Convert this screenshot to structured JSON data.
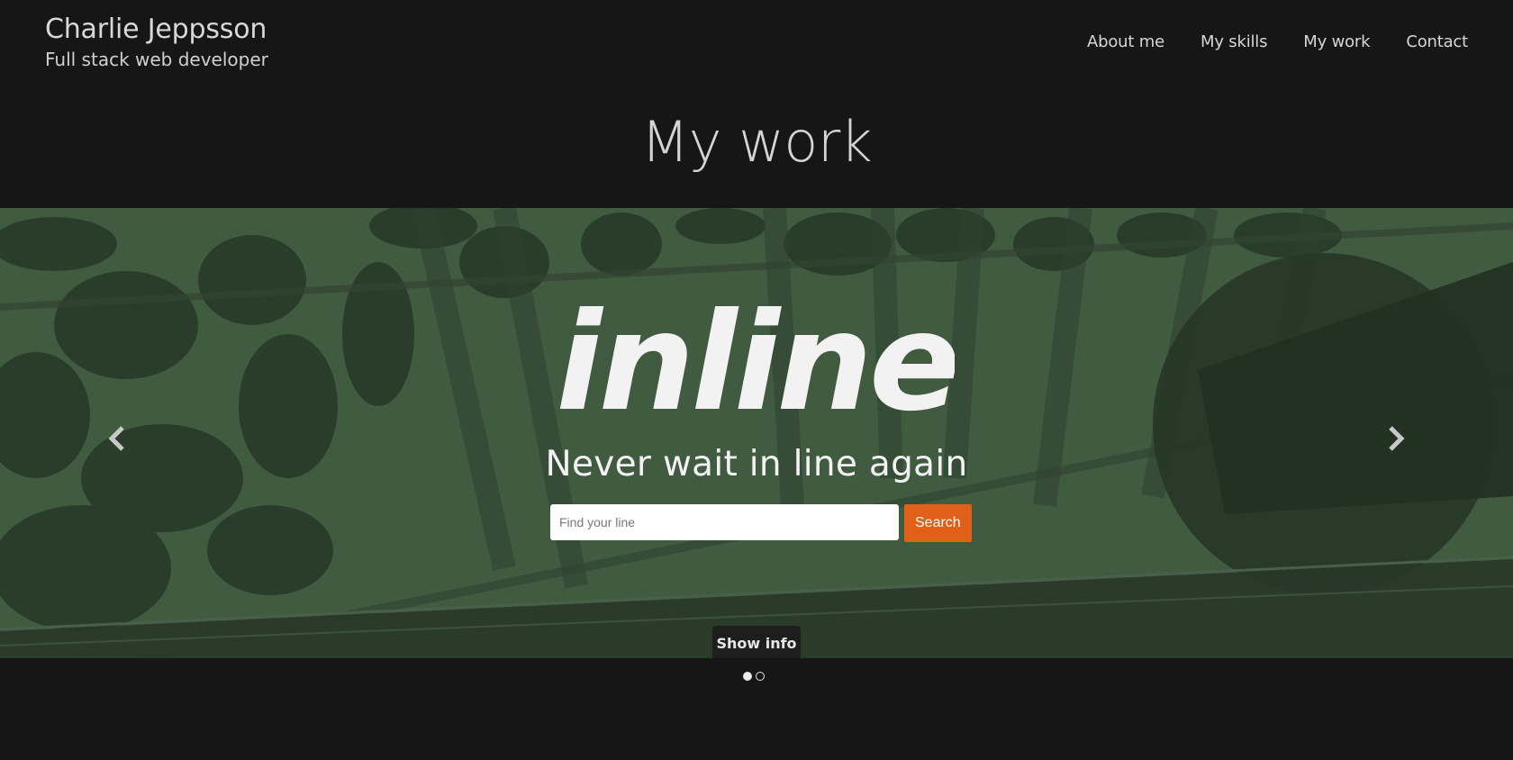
{
  "header": {
    "name": "Charlie Jeppsson",
    "subtitle": "Full stack web developer"
  },
  "nav": {
    "items": [
      "About me",
      "My skills",
      "My work",
      "Contact"
    ]
  },
  "page": {
    "title": "My work"
  },
  "carousel": {
    "logo_text": "inline",
    "tagline": "Never wait in line again",
    "search": {
      "placeholder": "Find your line",
      "button_label": "Search"
    },
    "show_info_label": "Show info",
    "active_slide": 1,
    "slide_count": 2,
    "prev_icon": "chevron-left-icon",
    "next_icon": "chevron-right-icon"
  },
  "colors": {
    "background": "#161616",
    "accent_orange": "#e0601a",
    "slide_tint": "#445a45",
    "text": "#d6d6d6"
  }
}
